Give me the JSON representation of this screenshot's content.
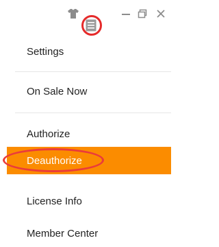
{
  "titlebar": {
    "icons": [
      "skin-icon",
      "menu-icon",
      "minimize-icon",
      "restore-icon",
      "close-icon"
    ],
    "menu_button_highlight_color": "#e52a2a"
  },
  "menu": {
    "items": [
      {
        "label": "Settings"
      },
      {
        "label": "On Sale Now"
      },
      {
        "label": "Authorize"
      },
      {
        "label": "Deauthorize",
        "selected": true
      },
      {
        "label": "License Info"
      },
      {
        "label": "Member Center"
      }
    ],
    "selected_background": "#fb8c00",
    "highlight_ellipse_color": "#ea3b3b"
  }
}
